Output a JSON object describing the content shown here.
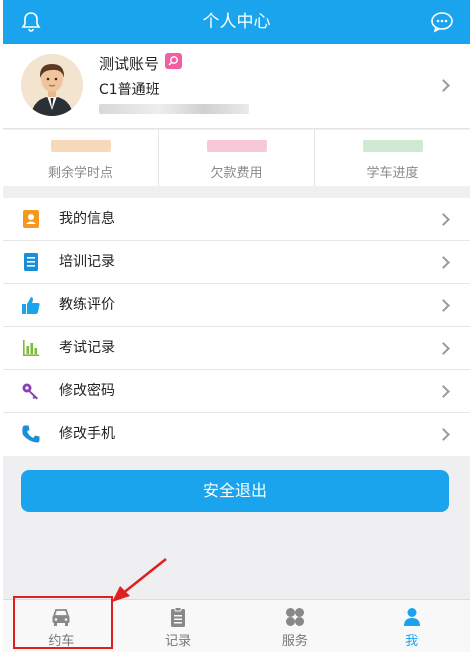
{
  "header": {
    "title": "个人中心",
    "bg_color": "#1aa4ee",
    "left_icon": "bell-icon",
    "right_icon": "chat-icon"
  },
  "profile": {
    "name": "测试账号",
    "class_name": "C1普通班"
  },
  "stats": [
    {
      "label": "剩余学时点",
      "blur_color": "#f6d9b8"
    },
    {
      "label": "欠款费用",
      "blur_color": "#f7c9d8"
    },
    {
      "label": "学车进度",
      "blur_color": "#cfe9d2"
    }
  ],
  "menu": [
    {
      "label": "我的信息",
      "icon": "user-card-icon",
      "icon_color": "#f39a1e"
    },
    {
      "label": "培训记录",
      "icon": "document-icon",
      "icon_color": "#1a8fd8"
    },
    {
      "label": "教练评价",
      "icon": "thumbs-up-icon",
      "icon_color": "#1aa4ee"
    },
    {
      "label": "考试记录",
      "icon": "bar-chart-icon",
      "icon_color": "#7cbb3a"
    },
    {
      "label": "修改密码",
      "icon": "key-icon",
      "icon_color": "#8a3fb0"
    },
    {
      "label": "修改手机",
      "icon": "phone-icon",
      "icon_color": "#1a8fd8"
    }
  ],
  "logout_label": "安全退出",
  "tabs": [
    {
      "label": "约车",
      "icon": "car-icon",
      "active": false
    },
    {
      "label": "记录",
      "icon": "clipboard-icon",
      "active": false
    },
    {
      "label": "服务",
      "icon": "grid-icon",
      "active": false
    },
    {
      "label": "我",
      "icon": "person-icon",
      "active": true
    }
  ],
  "accent_color": "#1aa4ee",
  "annotation_color": "#e02020"
}
